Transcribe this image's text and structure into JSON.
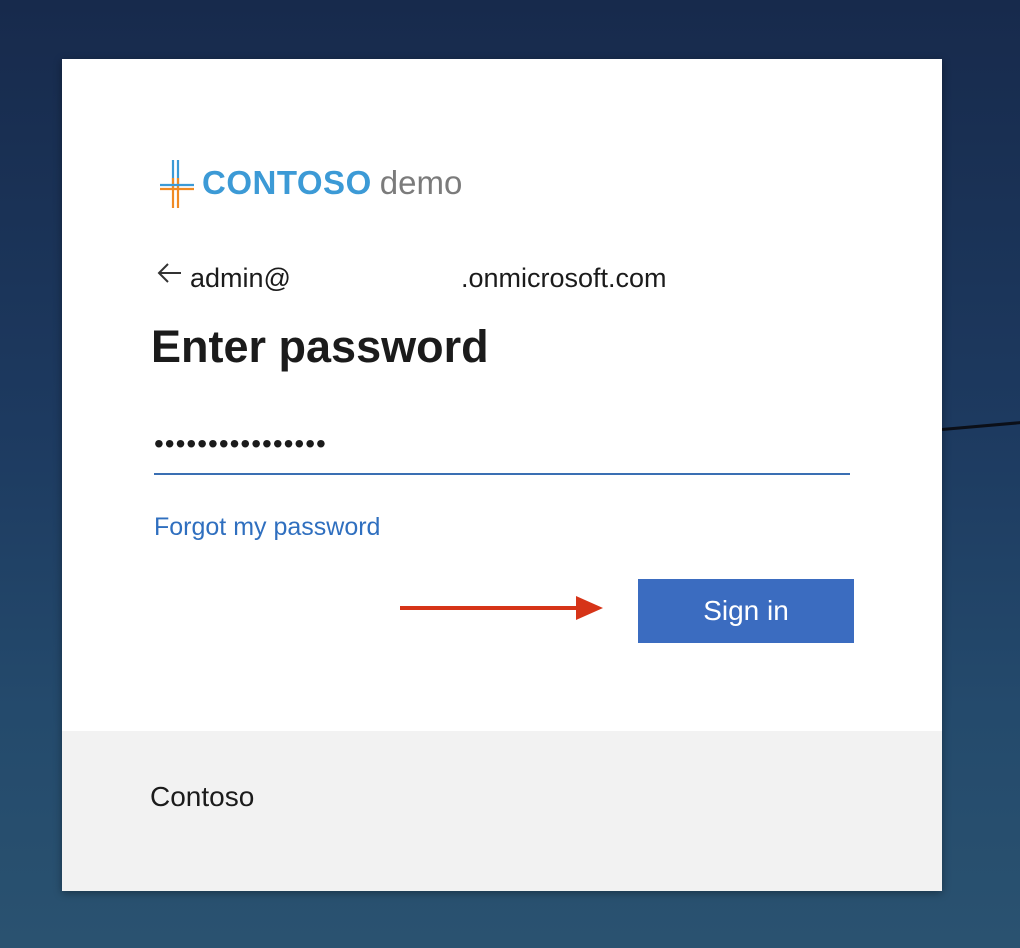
{
  "colors": {
    "background": "#1d3a60",
    "accent": "#3b6cc0",
    "link": "#2f6fbf",
    "brand_blue": "#3c9ad6",
    "brand_orange": "#f08a24",
    "annotation_arrow": "#d63418"
  },
  "logo": {
    "brand_main": "CONTOSO",
    "brand_sub": "demo"
  },
  "identity": {
    "back_icon": "arrow-left-icon",
    "email_prefix": "admin@",
    "email_suffix": ".onmicrosoft.com"
  },
  "title": "Enter password",
  "password": {
    "masked_value": "••••••••••••••••"
  },
  "links": {
    "forgot_password": "Forgot my password"
  },
  "buttons": {
    "sign_in": "Sign in"
  },
  "annotation": {
    "icon": "red-arrow-right-icon"
  },
  "footer": {
    "text": "Contoso"
  }
}
